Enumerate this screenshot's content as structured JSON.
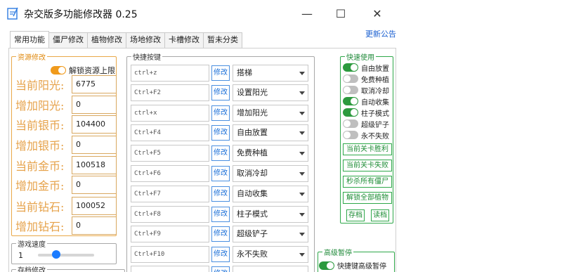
{
  "window": {
    "title": "杂交版多功能修改器  0.25",
    "minimize": "—",
    "maximize": "☐",
    "close": "✕"
  },
  "update_link": "更新公告",
  "tabs": [
    "常用功能",
    "僵尸修改",
    "植物修改",
    "场地修改",
    "卡槽修改",
    "暂未分类"
  ],
  "resource_group": {
    "title": "资源修改",
    "unlock_label": "解锁资源上限",
    "unlock_on": true,
    "rows": [
      {
        "label": "当前阳光:",
        "value": "6775"
      },
      {
        "label": "增加阳光:",
        "value": "0"
      },
      {
        "label": "当前银币:",
        "value": "104400"
      },
      {
        "label": "增加银币:",
        "value": "0"
      },
      {
        "label": "当前金币:",
        "value": "100518"
      },
      {
        "label": "增加金币:",
        "value": "0"
      },
      {
        "label": "当前钻石:",
        "value": "100052"
      },
      {
        "label": "增加钻石:",
        "value": "0"
      }
    ]
  },
  "speed_group": {
    "title": "游戏速度",
    "value": "1"
  },
  "save_group": {
    "title": "存档修改"
  },
  "hotkey_group": {
    "title": "快捷按键",
    "button_label": "修改",
    "rows": [
      {
        "key": "ctrl+z",
        "action": "搭梯"
      },
      {
        "key": "Ctrl+F2",
        "action": "设置阳光"
      },
      {
        "key": "ctrl+x",
        "action": "增加阳光"
      },
      {
        "key": "Ctrl+F4",
        "action": "自由放置"
      },
      {
        "key": "Ctrl+F5",
        "action": "免费种植"
      },
      {
        "key": "Ctrl+F6",
        "action": "取消冷却"
      },
      {
        "key": "Ctrl+F7",
        "action": "自动收集"
      },
      {
        "key": "Ctrl+F8",
        "action": "柱子模式"
      },
      {
        "key": "Ctrl+F9",
        "action": "超级铲子"
      },
      {
        "key": "Ctrl+F10",
        "action": "永不失败"
      }
    ]
  },
  "quick_group": {
    "title": "快速使用",
    "toggles": [
      {
        "label": "自由放置",
        "on": true
      },
      {
        "label": "免费种植",
        "on": false
      },
      {
        "label": "取消冷却",
        "on": false
      },
      {
        "label": "自动收集",
        "on": true
      },
      {
        "label": "柱子模式",
        "on": true
      },
      {
        "label": "超级铲子",
        "on": false
      },
      {
        "label": "永不失败",
        "on": false
      }
    ],
    "buttons": [
      "当前关卡胜利",
      "当前关卡失败",
      "秒杀所有僵尸",
      "解锁全部植物"
    ],
    "save_button": "存档",
    "load_button": "读档"
  },
  "pause_group": {
    "title": "高级暂停",
    "toggle_label": "快捷键高级暂停",
    "on": true
  }
}
